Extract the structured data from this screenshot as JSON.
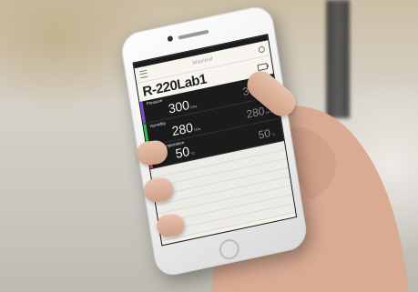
{
  "app": {
    "brand": "Maxitrol",
    "device_name": "R-220Lab1"
  },
  "readings": [
    {
      "label": "Pressure",
      "value": "300",
      "unit": "hPa",
      "secondary_value": "300",
      "secondary_unit": "hPa",
      "color": "#7b4fc7"
    },
    {
      "label": "Humidity",
      "value": "280",
      "unit": "hPa",
      "secondary_value": "280",
      "secondary_unit": "hPa",
      "color": "#2fbf5a"
    },
    {
      "label": "Sub Temperature",
      "value": "50",
      "unit": "°C",
      "secondary_value": "50",
      "secondary_unit": "°C",
      "color": "#e05252"
    }
  ],
  "log_rows": [
    {
      "left": "",
      "right": ""
    },
    {
      "left": "",
      "right": ""
    },
    {
      "left": "",
      "right": ""
    },
    {
      "left": "",
      "right": ""
    },
    {
      "left": "",
      "right": ""
    },
    {
      "left": "",
      "right": ""
    },
    {
      "left": "",
      "right": ""
    },
    {
      "left": "",
      "right": ""
    }
  ],
  "icons": {
    "menu": "menu-icon",
    "settings": "settings-icon",
    "battery": "battery-icon"
  }
}
